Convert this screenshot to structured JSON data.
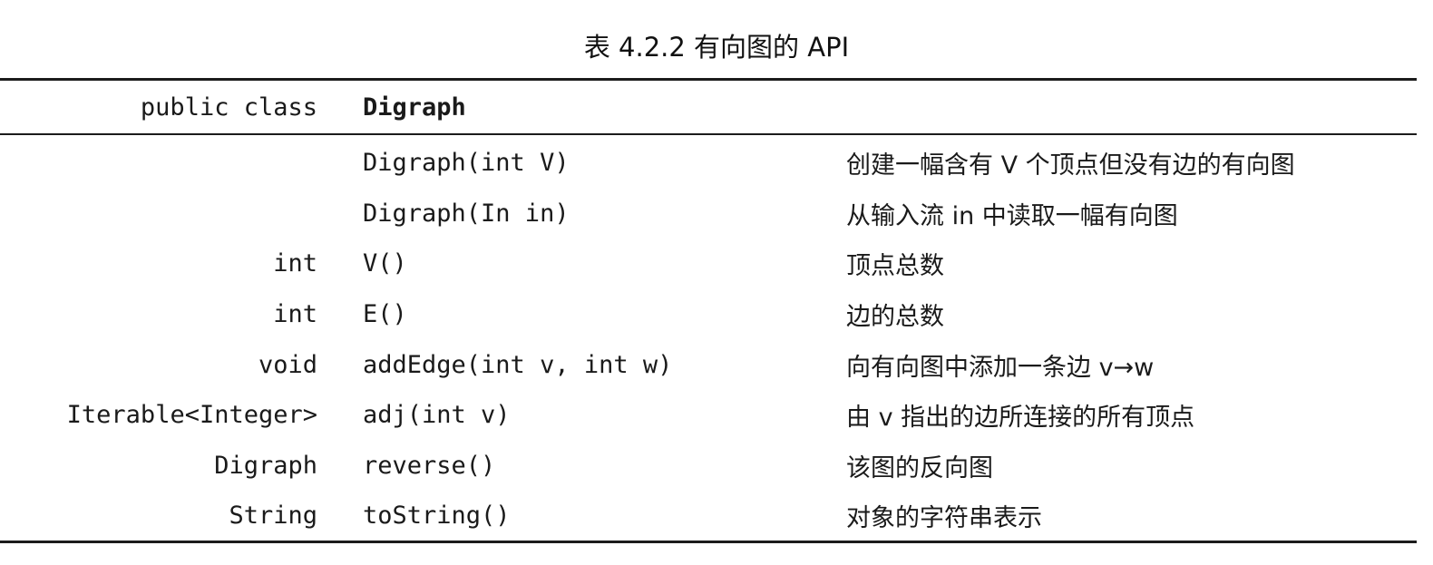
{
  "caption": "表 4.2.2    有向图的 API",
  "header": {
    "keyword": "public class",
    "class_name": "Digraph"
  },
  "rows": [
    {
      "type": "",
      "signature": "Digraph(int V)",
      "description": "创建一幅含有 V 个顶点但没有边的有向图"
    },
    {
      "type": "",
      "signature": "Digraph(In in)",
      "description": "从输入流 in 中读取一幅有向图"
    },
    {
      "type": "int",
      "signature": "V()",
      "description": "顶点总数"
    },
    {
      "type": "int",
      "signature": "E()",
      "description": "边的总数"
    },
    {
      "type": "void",
      "signature": "addEdge(int v, int w)",
      "description": "向有向图中添加一条边 v→w"
    },
    {
      "type": "Iterable<Integer>",
      "signature": "adj(int v)",
      "description": "由 v 指出的边所连接的所有顶点"
    },
    {
      "type": "Digraph",
      "signature": "reverse()",
      "description": "该图的反向图"
    },
    {
      "type": "String",
      "signature": "toString()",
      "description": "对象的字符串表示"
    }
  ]
}
